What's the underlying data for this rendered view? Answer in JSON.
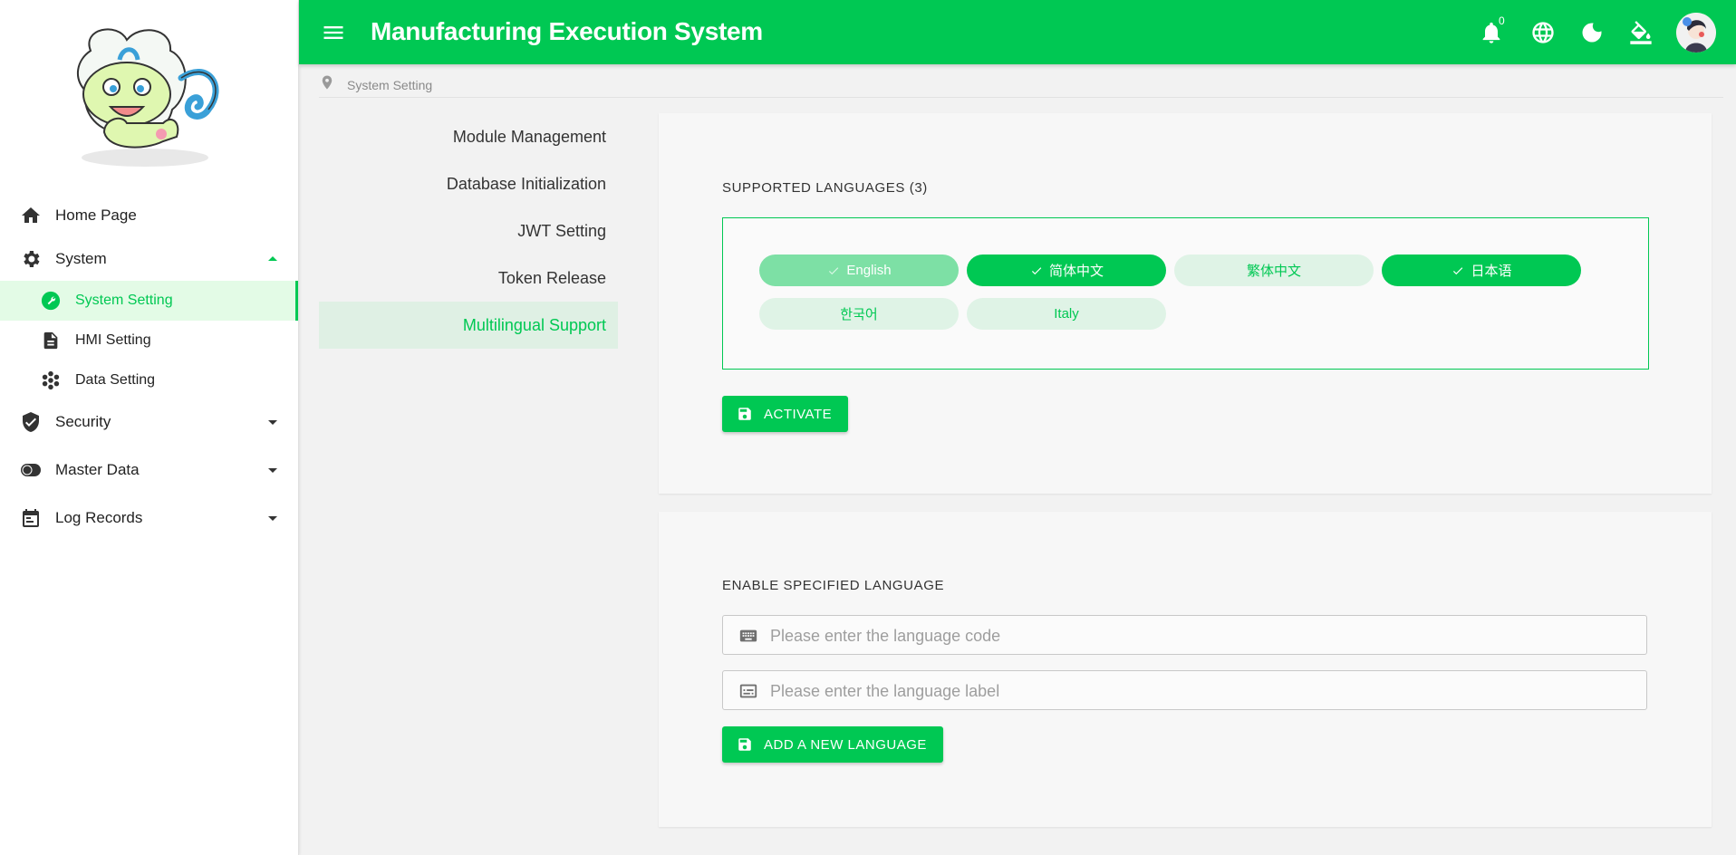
{
  "header": {
    "title": "Manufacturing Execution System",
    "notification_count": "0",
    "icons": [
      "menu-icon",
      "bell-icon",
      "globe-icon",
      "moon-icon",
      "paint-bucket-icon"
    ]
  },
  "sidebar": {
    "items": [
      {
        "label": "Home Page",
        "icon": "home-icon"
      },
      {
        "label": "System",
        "icon": "gear-icon",
        "expanded": true
      },
      {
        "label": "System Setting",
        "icon": "wrench-icon",
        "active": true
      },
      {
        "label": "HMI Setting",
        "icon": "document-icon"
      },
      {
        "label": "Data Setting",
        "icon": "hexagons-icon"
      },
      {
        "label": "Security",
        "icon": "shield-icon"
      },
      {
        "label": "Master Data",
        "icon": "toggle-icon"
      },
      {
        "label": "Log Records",
        "icon": "calendar-icon"
      }
    ]
  },
  "breadcrumb": {
    "current": "System Setting"
  },
  "tabs": [
    {
      "label": "Module Management"
    },
    {
      "label": "Database Initialization"
    },
    {
      "label": "JWT Setting"
    },
    {
      "label": "Token Release"
    },
    {
      "label": "Multilingual Support",
      "active": true
    }
  ],
  "supported": {
    "title": "SUPPORTED LANGUAGES (3)",
    "languages": [
      {
        "label": "English",
        "state": "selected-disabled"
      },
      {
        "label": "简体中文",
        "state": "selected"
      },
      {
        "label": "繁体中文",
        "state": "unselected"
      },
      {
        "label": "日本语",
        "state": "selected"
      },
      {
        "label": "한국어",
        "state": "unselected"
      },
      {
        "label": "Italy",
        "state": "unselected"
      }
    ],
    "activate_label": "ACTIVATE"
  },
  "enable": {
    "title": "ENABLE SPECIFIED LANGUAGE",
    "code_placeholder": "Please enter the language code",
    "label_placeholder": "Please enter the language label",
    "add_label": "ADD A NEW LANGUAGE"
  },
  "colors": {
    "primary": "#00c853",
    "active_bg": "#e3fbe6",
    "chip_unselected_bg": "#dff3e6"
  }
}
